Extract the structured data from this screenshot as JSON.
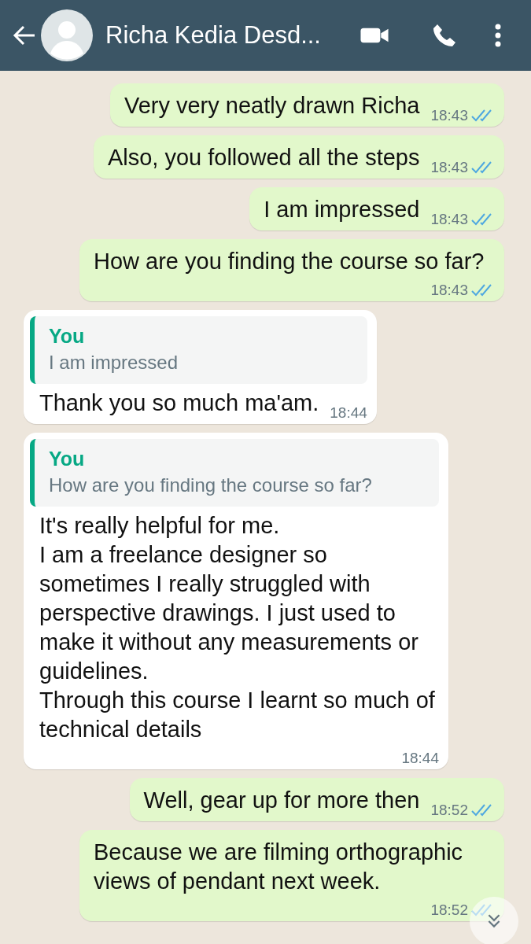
{
  "header": {
    "contact_name": "Richa Kedia Desd..."
  },
  "messages": [
    {
      "kind": "outgoing",
      "text": "Very very neatly drawn Richa",
      "time": "18:43",
      "read": true
    },
    {
      "kind": "outgoing",
      "text": "Also, you followed all the steps",
      "time": "18:43",
      "read": true
    },
    {
      "kind": "outgoing",
      "text": "I am impressed",
      "time": "18:43",
      "read": true
    },
    {
      "kind": "outgoing",
      "text": "How are you finding the course so far?",
      "time": "18:43",
      "read": true
    },
    {
      "kind": "incoming",
      "quote": {
        "author": "You",
        "text": "I am impressed"
      },
      "text": "Thank you so much ma'am.",
      "time": "18:44"
    },
    {
      "kind": "incoming",
      "quote": {
        "author": "You",
        "text": "How are you finding the course so far?"
      },
      "text": "It's really helpful for me.\nI am a freelance designer so sometimes I really struggled with perspective drawings. I just used to make it without any measurements or guidelines.\nThrough this course I learnt so much of technical details",
      "time": "18:44"
    },
    {
      "kind": "outgoing",
      "text": "Well, gear up for more then",
      "time": "18:52",
      "read": true
    },
    {
      "kind": "outgoing",
      "text": "Because we are filming orthographic views of pendant next week.",
      "time": "18:52",
      "read": true
    }
  ]
}
